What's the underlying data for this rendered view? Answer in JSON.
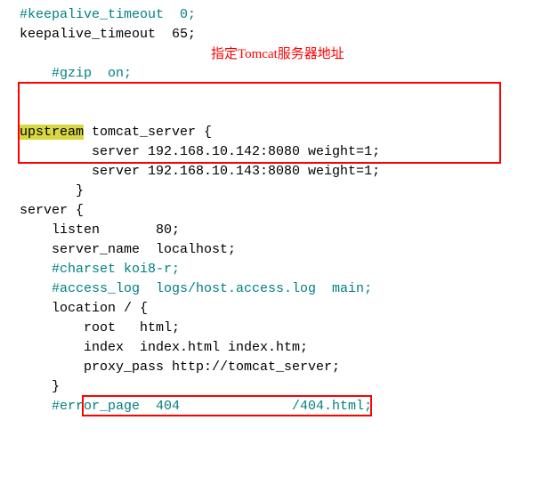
{
  "lines": {
    "l1": "#keepalive_timeout  0;",
    "l2": "keepalive_timeout  65;",
    "l3": "",
    "l4a": "#gzip  on;",
    "annotation": "指定Tomcat服务器地址",
    "l5_kw": "upstream",
    "l5_rest": " tomcat_server {",
    "l6": "         server 192.168.10.142:8080 weight=1;",
    "l7": "         server 192.168.10.143:8080 weight=1;",
    "l8": "       }",
    "l9": "",
    "l10": "server {",
    "l11": "    listen       80;",
    "l12": "    server_name  localhost;",
    "l13": "",
    "l14": "    #charset koi8-r;",
    "l15": "",
    "l16": "    #access_log  logs/host.access.log  main;",
    "l17": "",
    "l18": "    location / {",
    "l19": "        root   html;",
    "l20": "        index  index.html index.htm;",
    "l21": "        proxy_pass http://tomcat_server;",
    "l22": "    }",
    "l23": "",
    "l24": "    #error_page  404              /404.html;"
  }
}
